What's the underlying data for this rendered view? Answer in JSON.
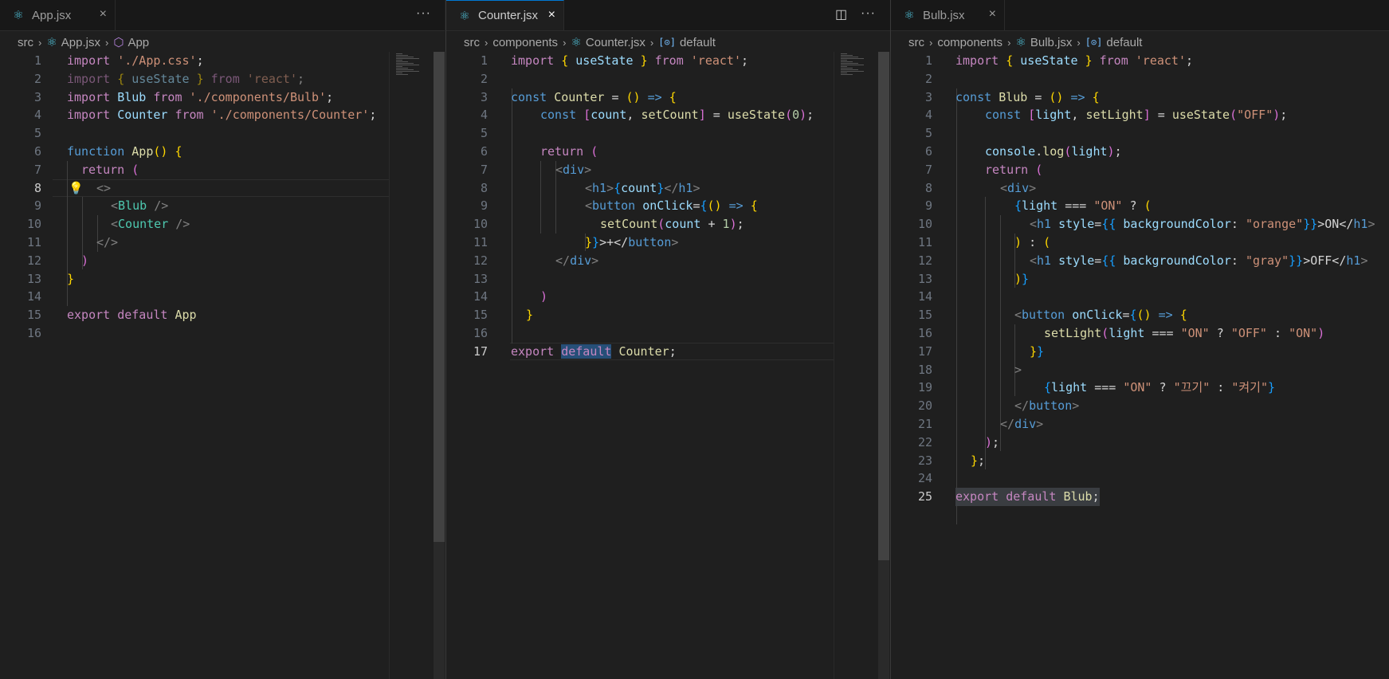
{
  "editors": [
    {
      "tab": {
        "label": "App.jsx",
        "close": "×",
        "more": "···"
      },
      "breadcrumb": [
        "src",
        "App.jsx",
        "App"
      ],
      "lines": [
        "1",
        "2",
        "3",
        "4",
        "5",
        "6",
        "7",
        "8",
        "9",
        "10",
        "11",
        "12",
        "13",
        "14",
        "15",
        "16"
      ],
      "current_line": "8"
    },
    {
      "tab": {
        "label": "Counter.jsx",
        "close": "×",
        "split": "◫",
        "more": "···"
      },
      "breadcrumb": [
        "src",
        "components",
        "Counter.jsx",
        "default"
      ],
      "lines": [
        "1",
        "2",
        "3",
        "4",
        "5",
        "6",
        "7",
        "8",
        "9",
        "10",
        "11",
        "12",
        "13",
        "14",
        "15",
        "16",
        "17"
      ],
      "current_line": "17"
    },
    {
      "tab": {
        "label": "Bulb.jsx",
        "close": "×"
      },
      "breadcrumb": [
        "src",
        "components",
        "Bulb.jsx",
        "default"
      ],
      "lines": [
        "1",
        "2",
        "3",
        "4",
        "5",
        "6",
        "7",
        "8",
        "9",
        "10",
        "11",
        "12",
        "13",
        "14",
        "15",
        "16",
        "17",
        "18",
        "19",
        "20",
        "21",
        "22",
        "23",
        "24",
        "25"
      ],
      "current_line": "25"
    }
  ],
  "code": {
    "app": {
      "l1a": "import",
      "l1b": "'./App.css'",
      "l1c": ";",
      "l2a": "import",
      "l2b": "{",
      "l2c": "useState",
      "l2d": "}",
      "l2e": "from",
      "l2f": "'react'",
      "l2g": ";",
      "l3a": "import",
      "l3b": "Blub",
      "l3c": "from",
      "l3d": "'./components/Bulb'",
      "l3e": ";",
      "l4a": "import",
      "l4b": "Counter",
      "l4c": "from",
      "l4d": "'./components/Counter'",
      "l4e": ";",
      "l6a": "function",
      "l6b": "App",
      "l6c": "()",
      "l6d": "{",
      "l7a": "return",
      "l7b": "(",
      "l8a": "<>",
      "l9a": "<",
      "l9b": "Blub",
      "l9c": "/>",
      "l10a": "<",
      "l10b": "Counter",
      "l10c": "/>",
      "l11a": "</>",
      "l12a": ")",
      "l13a": "}",
      "l15a": "export",
      "l15b": "default",
      "l15c": "App"
    },
    "counter": {
      "l1a": "import",
      "l1b": "{",
      "l1c": "useState",
      "l1d": "}",
      "l1e": "from",
      "l1f": "'react'",
      "l1g": ";",
      "l3a": "const",
      "l3b": "Counter",
      "l3c": "=",
      "l3d": "()",
      "l3e": "=>",
      "l3f": "{",
      "l4a": "const",
      "l4b": "[",
      "l4c": "count",
      "l4d": ",",
      "l4e": "setCount",
      "l4f": "]",
      "l4g": "=",
      "l4h": "useState",
      "l4i": "(",
      "l4j": "0",
      "l4k": ")",
      "l4l": ";",
      "l6a": "return",
      "l6b": "(",
      "l7a": "<",
      "l7b": "div",
      "l7c": ">",
      "l8a": "<",
      "l8b": "h1",
      "l8c": ">",
      "l8d": "{",
      "l8e": "count",
      "l8f": "}",
      "l8g": "</",
      "l8h": "h1",
      "l8i": ">",
      "l9a": "<",
      "l9b": "button",
      "l9c": "onClick",
      "l9d": "=",
      "l9e": "{",
      "l9f": "()",
      "l9g": "=>",
      "l9h": "{",
      "l10a": "setCount",
      "l10b": "(",
      "l10c": "count",
      "l10d": "+",
      "l10e": "1",
      "l10f": ")",
      "l10g": ";",
      "l11a": "}",
      "l11b": "}",
      "l11c": ">+</",
      "l11d": "button",
      "l11e": ">",
      "l12a": "</",
      "l12b": "div",
      "l12c": ">",
      "l14a": ")",
      "l15a": "}",
      "l17a": "export",
      "l17b": "default",
      "l17c": "Counter",
      "l17d": ";"
    },
    "bulb": {
      "l1a": "import",
      "l1b": "{",
      "l1c": "useState",
      "l1d": "}",
      "l1e": "from",
      "l1f": "'react'",
      "l1g": ";",
      "l3a": "const",
      "l3b": "Blub",
      "l3c": "=",
      "l3d": "()",
      "l3e": "=>",
      "l3f": "{",
      "l4a": "const",
      "l4b": "[",
      "l4c": "light",
      "l4d": ",",
      "l4e": "setLight",
      "l4f": "]",
      "l4g": "=",
      "l4h": "useState",
      "l4i": "(",
      "l4j": "\"OFF\"",
      "l4k": ")",
      "l4l": ";",
      "l6a": "console",
      "l6b": ".",
      "l6c": "log",
      "l6d": "(",
      "l6e": "light",
      "l6f": ")",
      "l6g": ";",
      "l7a": "return",
      "l7b": "(",
      "l8a": "<",
      "l8b": "div",
      "l8c": ">",
      "l9a": "{",
      "l9b": "light",
      "l9c": "===",
      "l9d": "\"ON\"",
      "l9e": "?",
      "l9f": "(",
      "l10a": "<",
      "l10b": "h1",
      "l10c": "style",
      "l10d": "=",
      "l10e": "{{",
      "l10f": "backgroundColor",
      "l10g": ":",
      "l10h": "\"orange\"",
      "l10i": "}}",
      "l10j": ">ON</",
      "l10k": "h1",
      "l10l": ">",
      "l11a": ")",
      "l11b": ":",
      "l11c": "(",
      "l12a": "<",
      "l12b": "h1",
      "l12c": "style",
      "l12d": "=",
      "l12e": "{{",
      "l12f": "backgroundColor",
      "l12g": ":",
      "l12h": "\"gray\"",
      "l12i": "}}",
      "l12j": ">OFF</",
      "l12k": "h1",
      "l12l": ">",
      "l13a": ")",
      "l13b": "}",
      "l15a": "<",
      "l15b": "button",
      "l15c": "onClick",
      "l15d": "=",
      "l15e": "{",
      "l15f": "()",
      "l15g": "=>",
      "l15h": "{",
      "l16a": "setLight",
      "l16b": "(",
      "l16c": "light",
      "l16d": "===",
      "l16e": "\"ON\"",
      "l16f": "?",
      "l16g": "\"OFF\"",
      "l16h": ":",
      "l16i": "\"ON\"",
      "l16j": ")",
      "l17a": "}",
      "l17b": "}",
      "l18a": ">",
      "l19a": "{",
      "l19b": "light",
      "l19c": "===",
      "l19d": "\"ON\"",
      "l19e": "?",
      "l19f": "\"끄기\"",
      "l19g": ":",
      "l19h": "\"켜기\"",
      "l19i": "}",
      "l20a": "</",
      "l20b": "button",
      "l20c": ">",
      "l21a": "</",
      "l21b": "div",
      "l21c": ">",
      "l22a": ")",
      "l22b": ";",
      "l23a": "}",
      "l23b": ";",
      "l25a": "export",
      "l25b": "default",
      "l25c": "Blub",
      "l25d": ";"
    }
  }
}
